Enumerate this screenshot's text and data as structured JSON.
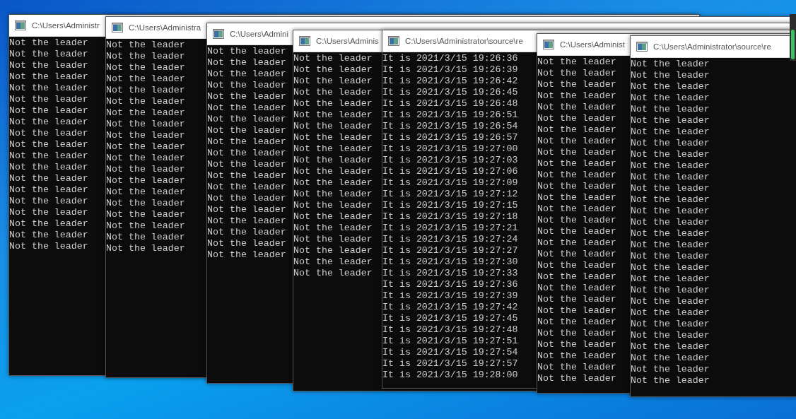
{
  "windows": [
    {
      "title": "C:\\Users\\Administr",
      "lines": [
        "Not the leader",
        "Not the leader",
        "Not the leader",
        "Not the leader",
        "Not the leader",
        "Not the leader",
        "Not the leader",
        "Not the leader",
        "Not the leader",
        "Not the leader",
        "Not the leader",
        "Not the leader",
        "Not the leader",
        "Not the leader",
        "Not the leader",
        "Not the leader",
        "Not the leader",
        "Not the leader",
        "Not the leader"
      ]
    },
    {
      "title": "C:\\Users\\Administra",
      "lines": [
        "Not the leader",
        "Not the leader",
        "Not the leader",
        "Not the leader",
        "Not the leader",
        "Not the leader",
        "Not the leader",
        "Not the leader",
        "Not the leader",
        "Not the leader",
        "Not the leader",
        "Not the leader",
        "Not the leader",
        "Not the leader",
        "Not the leader",
        "Not the leader",
        "Not the leader",
        "Not the leader",
        "Not the leader"
      ]
    },
    {
      "title": "C:\\Users\\Admini",
      "lines": [
        "Not the leader",
        "Not the leader",
        "Not the leader",
        "Not the leader",
        "Not the leader",
        "Not the leader",
        "Not the leader",
        "Not the leader",
        "Not the leader",
        "Not the leader",
        "Not the leader",
        "Not the leader",
        "Not the leader",
        "Not the leader",
        "Not the leader",
        "Not the leader",
        "Not the leader",
        "Not the leader",
        "Not the leader"
      ]
    },
    {
      "title": "C:\\Users\\Adminis",
      "lines": [
        "Not the leader",
        "Not the leader",
        "Not the leader",
        "Not the leader",
        "Not the leader",
        "Not the leader",
        "Not the leader",
        "Not the leader",
        "Not the leader",
        "Not the leader",
        "Not the leader",
        "Not the leader",
        "Not the leader",
        "Not the leader",
        "Not the leader",
        "Not the leader",
        "Not the leader",
        "Not the leader",
        "Not the leader",
        "Not the leader"
      ]
    },
    {
      "title": "C:\\Users\\Administrator\\source\\re",
      "lines": [
        "It is 2021/3/15 19:26:36",
        "It is 2021/3/15 19:26:39",
        "It is 2021/3/15 19:26:42",
        "It is 2021/3/15 19:26:45",
        "It is 2021/3/15 19:26:48",
        "It is 2021/3/15 19:26:51",
        "It is 2021/3/15 19:26:54",
        "It is 2021/3/15 19:26:57",
        "It is 2021/3/15 19:27:00",
        "It is 2021/3/15 19:27:03",
        "It is 2021/3/15 19:27:06",
        "It is 2021/3/15 19:27:09",
        "It is 2021/3/15 19:27:12",
        "It is 2021/3/15 19:27:15",
        "It is 2021/3/15 19:27:18",
        "It is 2021/3/15 19:27:21",
        "It is 2021/3/15 19:27:24",
        "It is 2021/3/15 19:27:27",
        "It is 2021/3/15 19:27:30",
        "It is 2021/3/15 19:27:33",
        "It is 2021/3/15 19:27:36",
        "It is 2021/3/15 19:27:39",
        "It is 2021/3/15 19:27:42",
        "It is 2021/3/15 19:27:45",
        "It is 2021/3/15 19:27:48",
        "It is 2021/3/15 19:27:51",
        "It is 2021/3/15 19:27:54",
        "It is 2021/3/15 19:27:57",
        "It is 2021/3/15 19:28:00"
      ]
    },
    {
      "title": "C:\\Users\\Administ",
      "lines": [
        "Not the leader",
        "Not the leader",
        "Not the leader",
        "Not the leader",
        "Not the leader",
        "Not the leader",
        "Not the leader",
        "Not the leader",
        "Not the leader",
        "Not the leader",
        "Not the leader",
        "Not the leader",
        "Not the leader",
        "Not the leader",
        "Not the leader",
        "Not the leader",
        "Not the leader",
        "Not the leader",
        "Not the leader",
        "Not the leader",
        "Not the leader",
        "Not the leader",
        "Not the leader",
        "Not the leader",
        "Not the leader",
        "Not the leader",
        "Not the leader",
        "Not the leader",
        "Not the leader"
      ]
    },
    {
      "title": "C:\\Users\\Administrator\\source\\re",
      "lines": [
        "Not the leader",
        "Not the leader",
        "Not the leader",
        "Not the leader",
        "Not the leader",
        "Not the leader",
        "Not the leader",
        "Not the leader",
        "Not the leader",
        "Not the leader",
        "Not the leader",
        "Not the leader",
        "Not the leader",
        "Not the leader",
        "Not the leader",
        "Not the leader",
        "Not the leader",
        "Not the leader",
        "Not the leader",
        "Not the leader",
        "Not the leader",
        "Not the leader",
        "Not the leader",
        "Not the leader",
        "Not the leader",
        "Not the leader",
        "Not the leader",
        "Not the leader",
        "Not the leader"
      ]
    }
  ]
}
